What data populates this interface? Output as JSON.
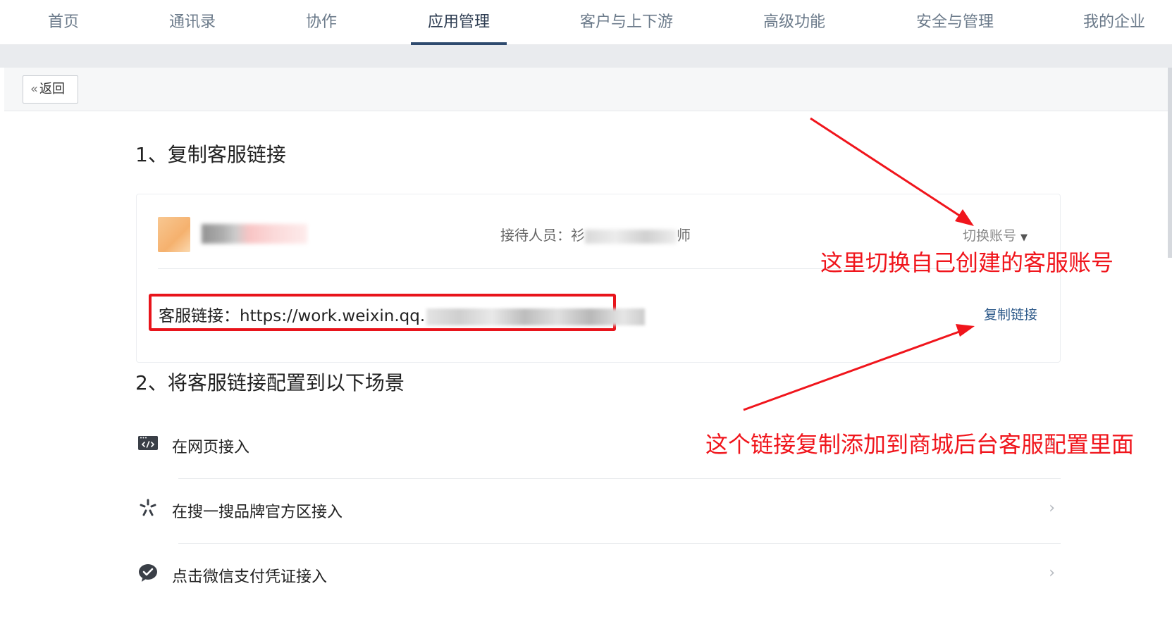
{
  "topnav": {
    "tabs": [
      {
        "label": "首页"
      },
      {
        "label": "通讯录"
      },
      {
        "label": "协作"
      },
      {
        "label": "应用管理"
      },
      {
        "label": "客户与上下游"
      },
      {
        "label": "高级功能"
      },
      {
        "label": "安全与管理"
      },
      {
        "label": "我的企业"
      }
    ],
    "active_tab": "应用管理"
  },
  "backbar": {
    "back_label": "返回"
  },
  "section1": {
    "title": "1、复制客服链接",
    "card": {
      "reception_prefix": "接待人员：衫",
      "reception_suffix": "师",
      "switch_account": "切换账号",
      "link_label": "客服链接：https://work.weixin.qq.",
      "copy_link": "复制链接"
    }
  },
  "section2": {
    "title": "2、将客服链接配置到以下场景",
    "items": [
      {
        "label": "在网页接入",
        "icon": "web-code-icon"
      },
      {
        "label": "在搜一搜品牌官方区接入",
        "icon": "sou-search-icon"
      },
      {
        "label": "点击微信支付凭证接入",
        "icon": "wechat-pay-icon"
      }
    ]
  },
  "annotations": {
    "switch_hint": "这里切换自己创建的客服账号",
    "copy_hint": "这个链接复制添加到商城后台客服配置里面",
    "color": "#f0151c"
  }
}
